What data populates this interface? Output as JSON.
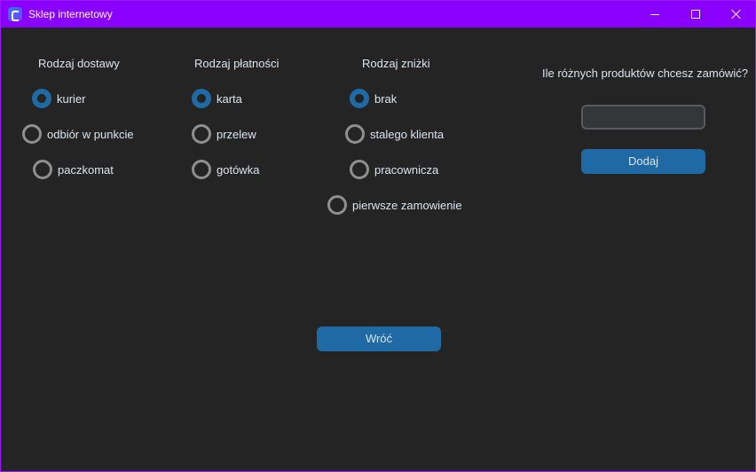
{
  "window": {
    "title": "Sklep internetowy",
    "accent": "#8a00ff",
    "icons": [
      "app-icon",
      "minimize-icon",
      "maximize-icon",
      "close-icon"
    ]
  },
  "delivery": {
    "heading": "Rodzaj dostawy",
    "options": [
      {
        "label": "kurier",
        "selected": true
      },
      {
        "label": "odbiór w punkcie",
        "selected": false
      },
      {
        "label": "paczkomat",
        "selected": false
      }
    ]
  },
  "payment": {
    "heading": "Rodzaj płatności",
    "options": [
      {
        "label": "karta",
        "selected": true
      },
      {
        "label": "przelew",
        "selected": false
      },
      {
        "label": "gotówka",
        "selected": false
      }
    ]
  },
  "discount": {
    "heading": "Rodzaj zniżki",
    "options": [
      {
        "label": "brak",
        "selected": true
      },
      {
        "label": "stalego klienta",
        "selected": false
      },
      {
        "label": "pracownicza",
        "selected": false
      },
      {
        "label": "pierwsze zamowienie",
        "selected": false
      }
    ]
  },
  "products": {
    "question": "Ile różnych produktów chcesz zamówić?",
    "value": "",
    "add_label": "Dodaj"
  },
  "back_label": "Wróć",
  "colors": {
    "background": "#242424",
    "button": "#1f6aa5",
    "text": "#dce4ee",
    "radio_unselected": "#8f8f8f"
  }
}
